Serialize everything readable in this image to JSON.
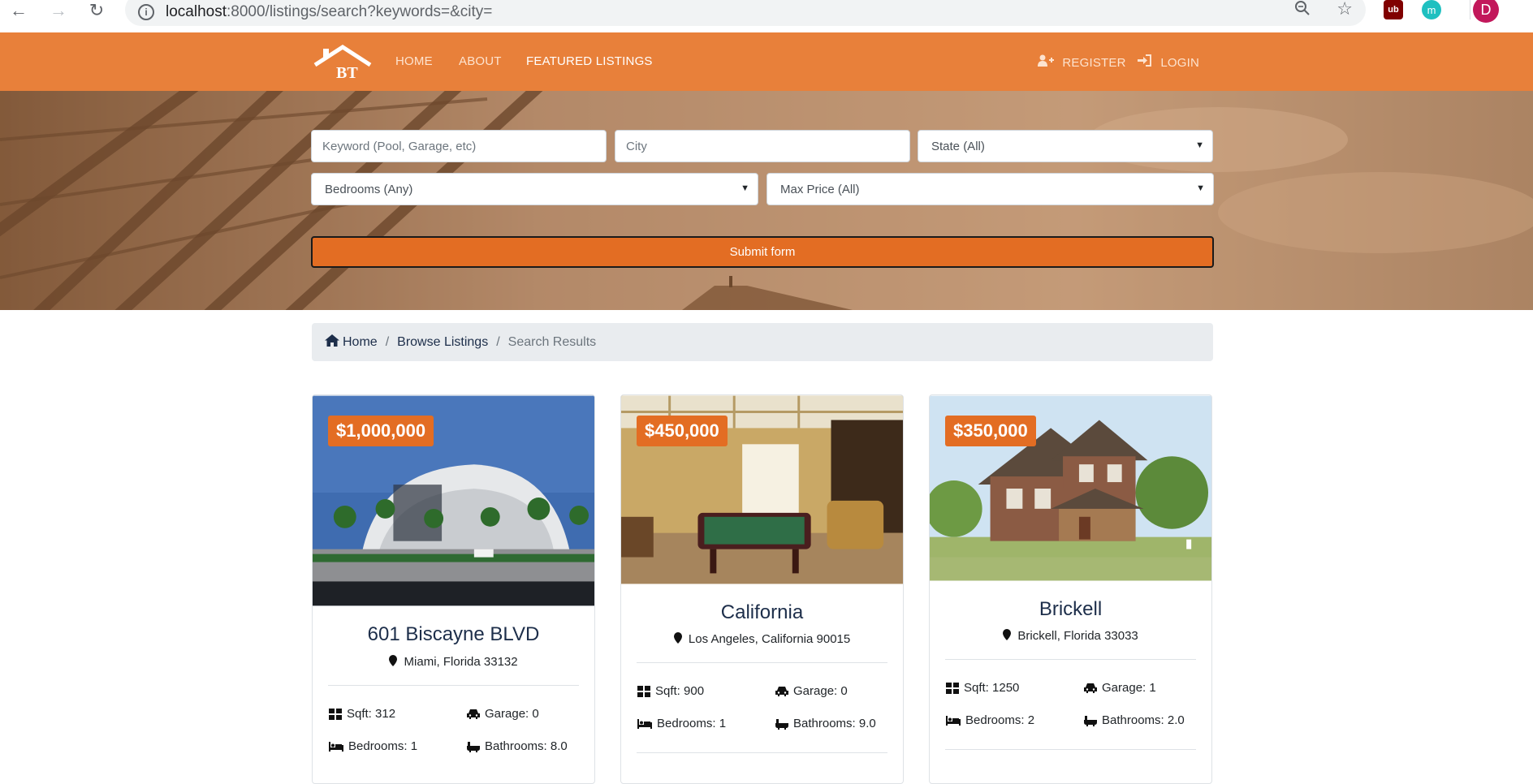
{
  "browser": {
    "url_host": "localhost",
    "url_rest": ":8000/listings/search?keywords=&city=",
    "avatar_letter": "D",
    "ext_ub": "ub",
    "ext_m": "m"
  },
  "navbar": {
    "logo_text": "BT",
    "links": [
      "HOME",
      "ABOUT",
      "FEATURED LISTINGS"
    ],
    "register": "REGISTER",
    "login": "LOGIN",
    "color": "#e8803a"
  },
  "search": {
    "keyword_placeholder": "Keyword (Pool, Garage, etc)",
    "city_placeholder": "City",
    "state_selected": "State (All)",
    "bedrooms_selected": "Bedrooms (Any)",
    "price_selected": "Max Price (All)",
    "submit_label": "Submit form"
  },
  "breadcrumb": {
    "home": "Home",
    "browse": "Browse Listings",
    "current": "Search Results"
  },
  "listings": [
    {
      "price": "$1,000,000",
      "title": "601 Biscayne BLVD",
      "location": "Miami, Florida 33132",
      "sqft": "Sqft: 312",
      "garage": "Garage: 0",
      "bedrooms": "Bedrooms: 1",
      "bathrooms": "Bathrooms: 8.0"
    },
    {
      "price": "$450,000",
      "title": "California",
      "location": "Los Angeles, California 90015",
      "sqft": "Sqft: 900",
      "garage": "Garage: 0",
      "bedrooms": "Bedrooms: 1",
      "bathrooms": "Bathrooms: 9.0"
    },
    {
      "price": "$350,000",
      "title": "Brickell",
      "location": "Brickell, Florida 33033",
      "sqft": "Sqft: 1250",
      "garage": "Garage: 1",
      "bedrooms": "Bedrooms: 2",
      "bathrooms": "Bathrooms: 2.0"
    }
  ],
  "icons": {
    "back": "arrow-left-icon",
    "forward": "arrow-right-icon",
    "reload": "reload-icon",
    "info": "info-icon",
    "zoom": "zoom-icon",
    "star": "star-icon",
    "home": "home-icon",
    "map_marker": "map-marker-icon",
    "sqft": "grid-icon",
    "garage": "car-icon",
    "bed": "bed-icon",
    "bath": "bath-icon"
  }
}
